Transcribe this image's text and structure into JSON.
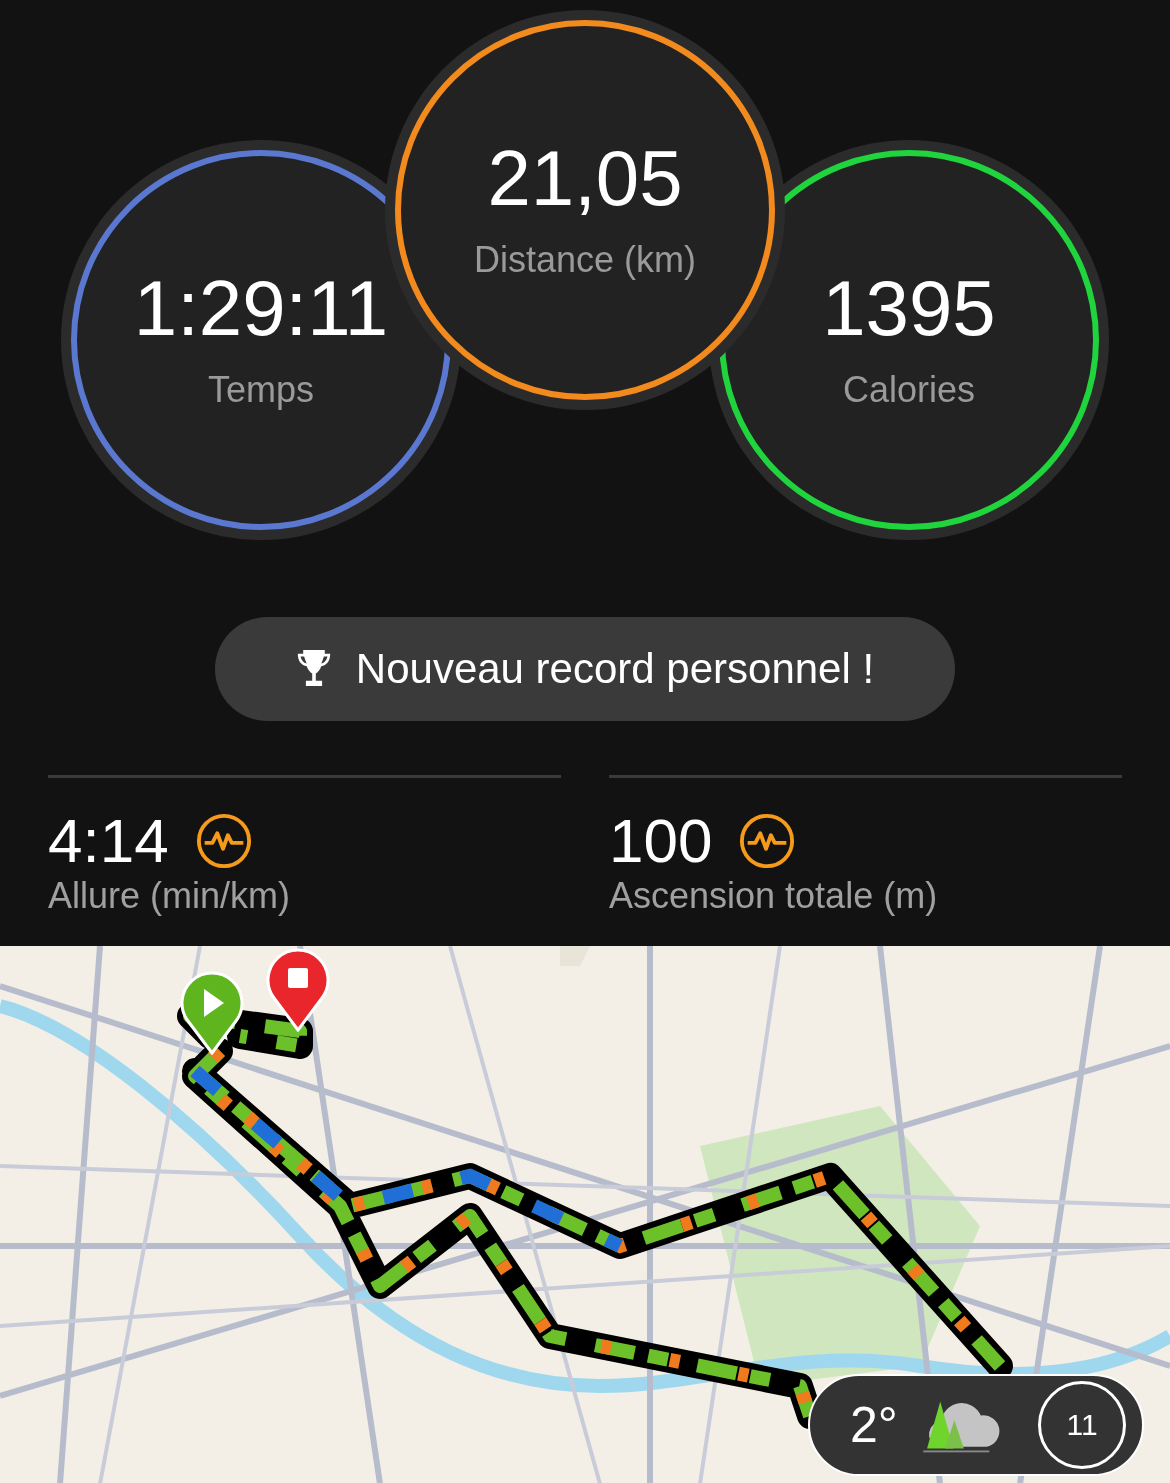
{
  "summary_rings": [
    {
      "value": "1:29:11",
      "label": "Temps",
      "color": "#5a78d0",
      "raised": false
    },
    {
      "value": "21,05",
      "label": "Distance (km)",
      "color": "#f28a1e",
      "raised": true
    },
    {
      "value": "1395",
      "label": "Calories",
      "color": "#1fd43c",
      "raised": false
    }
  ],
  "record_banner": {
    "text": "Nouveau record personnel !"
  },
  "stats": [
    {
      "value": "4:14",
      "label": "Allure (min/km)"
    },
    {
      "value": "100",
      "label": "Ascension totale (m)"
    }
  ],
  "map": {
    "kind": "picture",
    "weather": {
      "temperature": "2°",
      "clock": "11"
    }
  }
}
